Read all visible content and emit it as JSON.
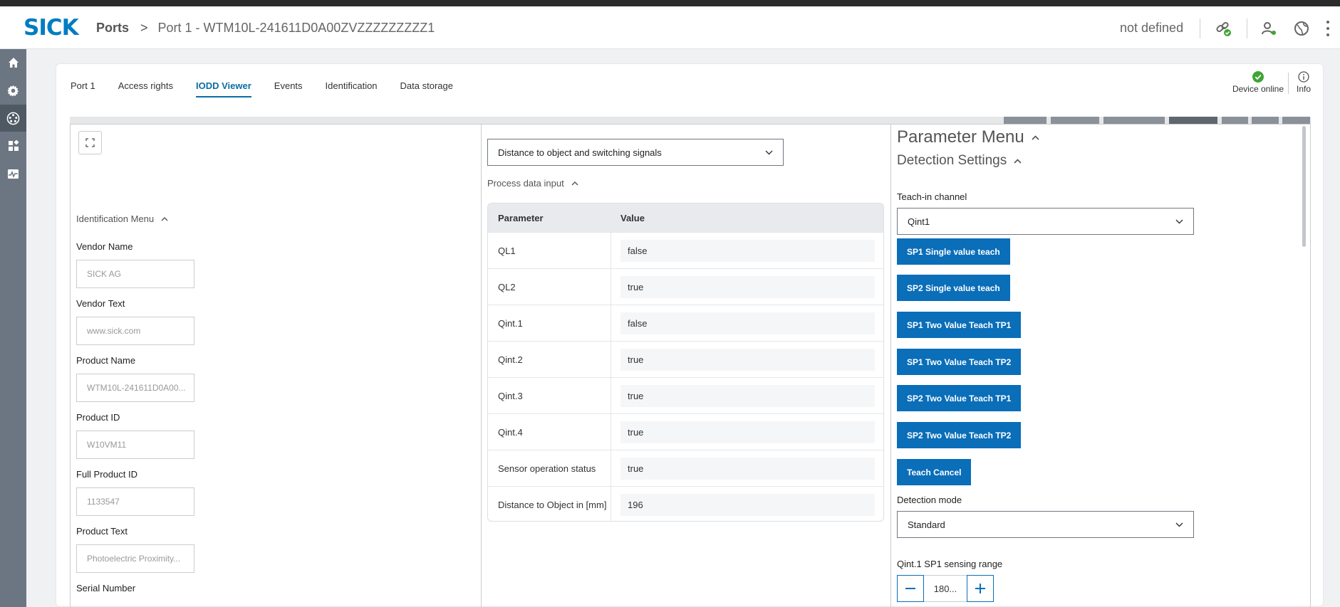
{
  "header": {
    "logo": "SICK",
    "breadcrumb_root": "Ports",
    "breadcrumb_sep": ">",
    "breadcrumb_current": "Port 1 - WTM10L-241611D0A00ZVZZZZZZZZZ1",
    "status": "not defined"
  },
  "sidebar": {
    "items": [
      {
        "icon": "home-icon"
      },
      {
        "icon": "gear-icon"
      },
      {
        "icon": "ports-icon"
      },
      {
        "icon": "apps-icon"
      },
      {
        "icon": "monitor-icon"
      }
    ]
  },
  "tabs": [
    "Port 1",
    "Access rights",
    "IODD Viewer",
    "Events",
    "Identification",
    "Data storage"
  ],
  "active_tab": "IODD Viewer",
  "device_status": {
    "label": "Device online",
    "info_label": "Info"
  },
  "identification": {
    "title": "Identification Menu",
    "fields": [
      {
        "label": "Vendor Name",
        "value": "SICK AG"
      },
      {
        "label": "Vendor Text",
        "value": "www.sick.com"
      },
      {
        "label": "Product Name",
        "value": "WTM10L-241611D0A00..."
      },
      {
        "label": "Product ID",
        "value": "W10VM11"
      },
      {
        "label": "Full Product ID",
        "value": "1133547"
      },
      {
        "label": "Product Text",
        "value": "Photoelectric Proximity..."
      },
      {
        "label": "Serial Number",
        "value": ""
      }
    ]
  },
  "process": {
    "select_value": "Distance to object and switching signals",
    "section_title": "Process data input",
    "col_param": "Parameter",
    "col_value": "Value",
    "rows": [
      {
        "param": "QL1",
        "value": "false"
      },
      {
        "param": "QL2",
        "value": "true"
      },
      {
        "param": "Qint.1",
        "value": "false"
      },
      {
        "param": "Qint.2",
        "value": "true"
      },
      {
        "param": "Qint.3",
        "value": "true"
      },
      {
        "param": "Qint.4",
        "value": "true"
      },
      {
        "param": "Sensor operation status",
        "value": "true"
      },
      {
        "param": "Distance to Object in [mm]",
        "value": "196"
      }
    ]
  },
  "param_menu": {
    "title": "Parameter Menu",
    "detection_title": "Detection Settings",
    "teach_label": "Teach-in channel",
    "teach_value": "Qint1",
    "buttons": [
      "SP1 Single value teach",
      "SP2 Single value teach",
      "SP1 Two Value Teach TP1",
      "SP1 Two Value Teach TP2",
      "SP2 Two Value Teach TP1",
      "SP2 Two Value Teach TP2",
      "Teach Cancel"
    ],
    "mode_label": "Detection mode",
    "mode_value": "Standard",
    "range_label": "Qint.1 SP1 sensing range",
    "range_value": "180..."
  },
  "colors": {
    "accent": "#0a6eb9",
    "brand": "#007cc1",
    "online": "#3fa535",
    "sidebar": "#6c7682"
  }
}
